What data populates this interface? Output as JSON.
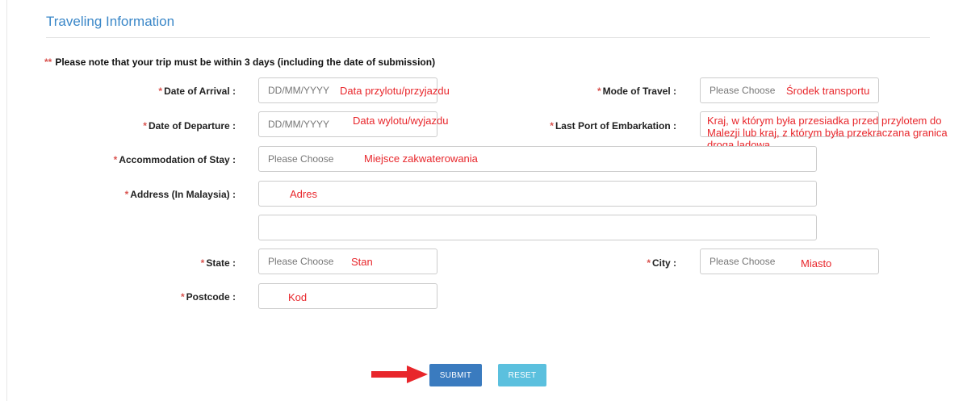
{
  "section": {
    "title": "Traveling Information",
    "note_stars": "**",
    "note": "Please note that your trip must be within 3 days (including the date of submission)"
  },
  "required_mark": "*",
  "fields": {
    "date_of_arrival": {
      "label": "Date of Arrival :",
      "placeholder": "DD/MM/YYYY",
      "annotation": "Data przylotu/przyjazdu"
    },
    "mode_of_travel": {
      "label": "Mode of Travel :",
      "placeholder": "Please Choose",
      "annotation": "Środek transportu"
    },
    "date_of_departure": {
      "label": "Date of Departure :",
      "placeholder": "DD/MM/YYYY",
      "annotation": "Data wylotu/wyjazdu"
    },
    "last_port": {
      "label": "Last Port of Embarkation :",
      "annotation": "Kraj, w którym była przesiadka przed przylotem do Malezji lub kraj, z którym była przekraczana granica droga lądową"
    },
    "accommodation": {
      "label": "Accommodation of Stay :",
      "placeholder": "Please Choose",
      "annotation": "Miejsce zakwaterowania"
    },
    "address": {
      "label": "Address (In Malaysia) :",
      "annotation": "Adres",
      "line2": ""
    },
    "state": {
      "label": "State :",
      "placeholder": "Please Choose",
      "annotation": "Stan"
    },
    "city": {
      "label": "City :",
      "placeholder": "Please Choose",
      "annotation": "Miasto"
    },
    "postcode": {
      "label": "Postcode :",
      "annotation": "Kod"
    }
  },
  "buttons": {
    "submit": "SUBMIT",
    "reset": "RESET"
  },
  "colors": {
    "accent": "#3a87c8",
    "required": "#d9534f",
    "annotation": "#e8262b",
    "arrow": "#e8262b",
    "submit": "#3a7bbf",
    "reset": "#5bc0de"
  }
}
